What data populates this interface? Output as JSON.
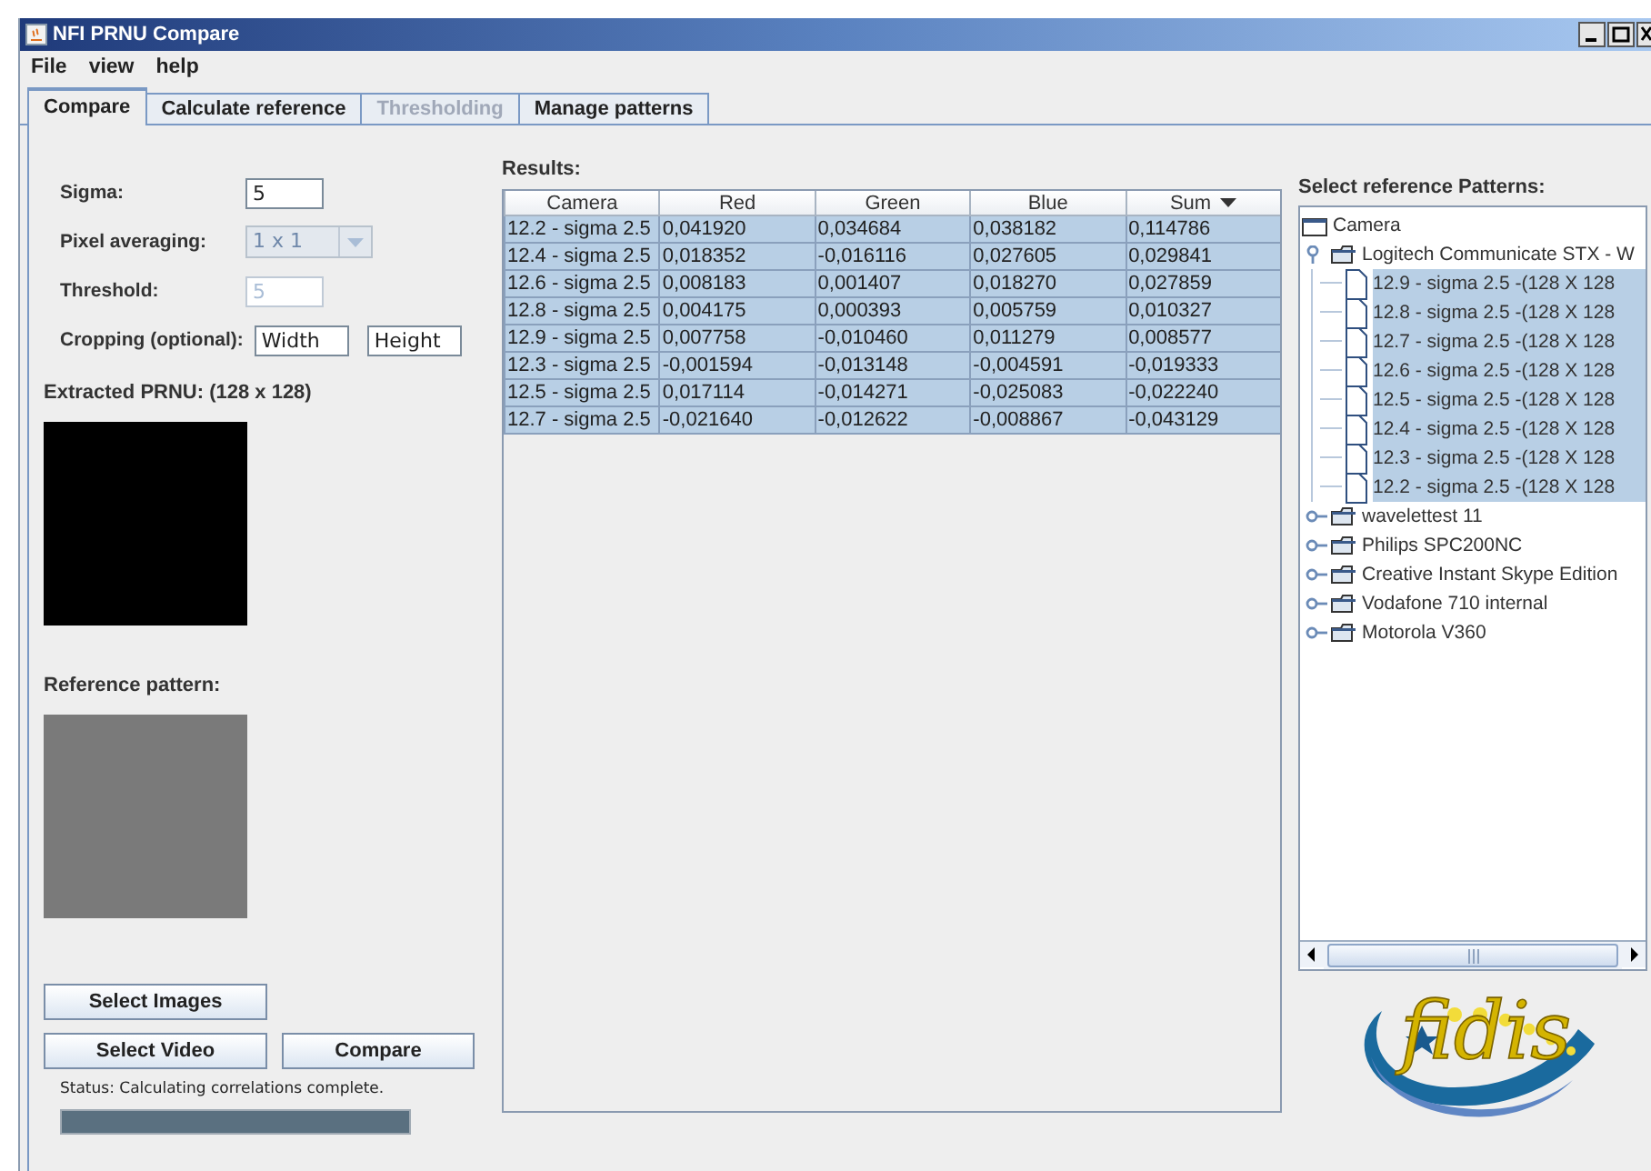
{
  "window": {
    "title": "NFI PRNU Compare"
  },
  "menu": [
    {
      "label": "File"
    },
    {
      "label": "view"
    },
    {
      "label": "help"
    }
  ],
  "tabs": [
    {
      "label": "Compare",
      "selected": true,
      "disabled": false
    },
    {
      "label": "Calculate reference",
      "selected": false,
      "disabled": false
    },
    {
      "label": "Thresholding",
      "selected": false,
      "disabled": true
    },
    {
      "label": "Manage patterns",
      "selected": false,
      "disabled": false
    }
  ],
  "settings": [
    {
      "kind": "text",
      "label": "Sigma:",
      "values": [
        "5"
      ],
      "disabled": false
    },
    {
      "kind": "combo",
      "label": "Pixel averaging:",
      "values": [
        "1 x 1"
      ],
      "disabled": true
    },
    {
      "kind": "text",
      "label": "Threshold:",
      "values": [
        "5"
      ],
      "disabled": true
    },
    {
      "kind": "text",
      "label": "Cropping (optional):",
      "values": [
        "Width",
        "Height"
      ],
      "disabled": false
    }
  ],
  "previews": [
    {
      "label": "Extracted PRNU: (128 x 128)"
    },
    {
      "label": "Reference pattern:"
    }
  ],
  "buttons": [
    [
      "Select Images"
    ],
    [
      "Select Video",
      "Compare"
    ]
  ],
  "status": "Status: Calculating correlations complete.",
  "progress": {
    "level": 1
  },
  "results": {
    "title": "Results:",
    "columns": [
      {
        "label": "Camera",
        "sorted": false
      },
      {
        "label": "Red",
        "sorted": false
      },
      {
        "label": "Green",
        "sorted": false
      },
      {
        "label": "Blue",
        "sorted": false
      },
      {
        "label": "Sum",
        "sorted": true
      }
    ],
    "rows": [
      {
        "selected": true,
        "cells": [
          "12.2 - sigma 2.5",
          "0,041920",
          "0,034684",
          "0,038182",
          "0,114786"
        ]
      },
      {
        "selected": true,
        "cells": [
          "12.4 - sigma 2.5",
          "0,018352",
          "-0,016116",
          "0,027605",
          "0,029841"
        ]
      },
      {
        "selected": true,
        "cells": [
          "12.6 - sigma 2.5",
          "0,008183",
          "0,001407",
          "0,018270",
          "0,027859"
        ]
      },
      {
        "selected": true,
        "cells": [
          "12.8 - sigma 2.5",
          "0,004175",
          "0,000393",
          "0,005759",
          "0,010327"
        ]
      },
      {
        "selected": true,
        "cells": [
          "12.9 - sigma 2.5",
          "0,007758",
          "-0,010460",
          "0,011279",
          "0,008577"
        ]
      },
      {
        "selected": true,
        "cells": [
          "12.3 - sigma 2.5",
          "-0,001594",
          "-0,013148",
          "-0,004591",
          "-0,019333"
        ]
      },
      {
        "selected": true,
        "cells": [
          "12.5 - sigma 2.5",
          "0,017114",
          "-0,014271",
          "-0,025083",
          "-0,022240"
        ]
      },
      {
        "selected": true,
        "cells": [
          "12.7 - sigma 2.5",
          "-0,021640",
          "-0,012622",
          "-0,008867",
          "-0,043129"
        ]
      }
    ]
  },
  "patterns": {
    "title": "Select reference Patterns:",
    "tree": {
      "label": "Camera",
      "kind": "folder",
      "expanded": true,
      "selected": false,
      "children": [
        {
          "label": "Logitech Communicate STX - W",
          "kind": "folder",
          "expanded": true,
          "selected": false,
          "children": [
            {
              "label": "12.9 - sigma 2.5 -(128 X 128",
              "kind": "file",
              "selected": true
            },
            {
              "label": "12.8 - sigma 2.5 -(128 X 128",
              "kind": "file",
              "selected": true
            },
            {
              "label": "12.7 - sigma 2.5 -(128 X 128",
              "kind": "file",
              "selected": true
            },
            {
              "label": "12.6 - sigma 2.5 -(128 X 128",
              "kind": "file",
              "selected": true
            },
            {
              "label": "12.5 - sigma 2.5 -(128 X 128",
              "kind": "file",
              "selected": true
            },
            {
              "label": "12.4 - sigma 2.5 -(128 X 128",
              "kind": "file",
              "selected": true
            },
            {
              "label": "12.3 - sigma 2.5 -(128 X 128",
              "kind": "file",
              "selected": true
            },
            {
              "label": "12.2 - sigma 2.5 -(128 X 128",
              "kind": "file",
              "selected": true
            }
          ]
        },
        {
          "label": "wavelettest 11",
          "kind": "folder",
          "expanded": false,
          "selected": false
        },
        {
          "label": "Philips SPC200NC",
          "kind": "folder",
          "expanded": false,
          "selected": false
        },
        {
          "label": "Creative Instant Skype Edition",
          "kind": "folder",
          "expanded": false,
          "selected": false
        },
        {
          "label": "Vodafone 710 internal",
          "kind": "folder",
          "expanded": false,
          "selected": false
        },
        {
          "label": "Motorola V360",
          "kind": "folder",
          "expanded": false,
          "selected": false
        }
      ]
    }
  },
  "logo": {
    "text": "fidis"
  }
}
